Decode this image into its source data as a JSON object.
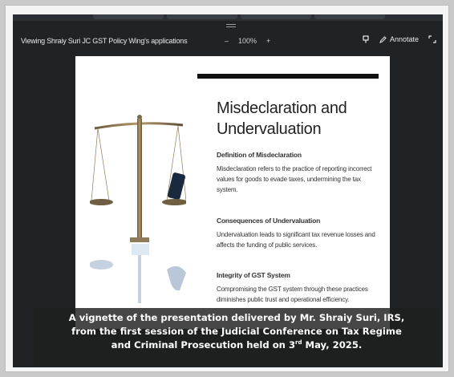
{
  "window": {
    "title": "Viewing Shraiy Suri JC GST Policy Wing's applications"
  },
  "toolbar": {
    "zoom_out": "–",
    "zoom_level": "100%",
    "zoom_in": "+",
    "annotate_label": "Annotate"
  },
  "slide": {
    "title_line1": "Misdeclaration and",
    "title_line2": "Undervaluation",
    "sections": [
      {
        "heading": "Definition of Misdeclaration",
        "body": "Misdeclaration refers to the practice of reporting incorrect values for goods to evade taxes, undermining the tax system."
      },
      {
        "heading": "Consequences of Undervaluation",
        "body": "Undervaluation leads to significant tax revenue losses and affects the funding of public services."
      },
      {
        "heading": "Integrity of GST System",
        "body": "Compromising the GST system through these practices diminishes public trust and operational efficiency."
      }
    ]
  },
  "caption": {
    "line1": "A vignette of the presentation delivered by Mr. Shraiy Suri, IRS,",
    "line2": "from the first session of the Judicial Conference on Tax Regime",
    "line3_pre": "and Criminal Prosecution held on 3",
    "line3_sup": "rd",
    "line3_post": " May, 2025."
  },
  "colors": {
    "viewer_bg": "#1f2326",
    "toolbar_text": "#e8eaed",
    "slide_bg": "#ffffff",
    "caption_bg": "#1e1e1e"
  },
  "icons": [
    "drag-handle-icon",
    "pin-icon",
    "annotate-pen-icon",
    "expand-icon"
  ]
}
